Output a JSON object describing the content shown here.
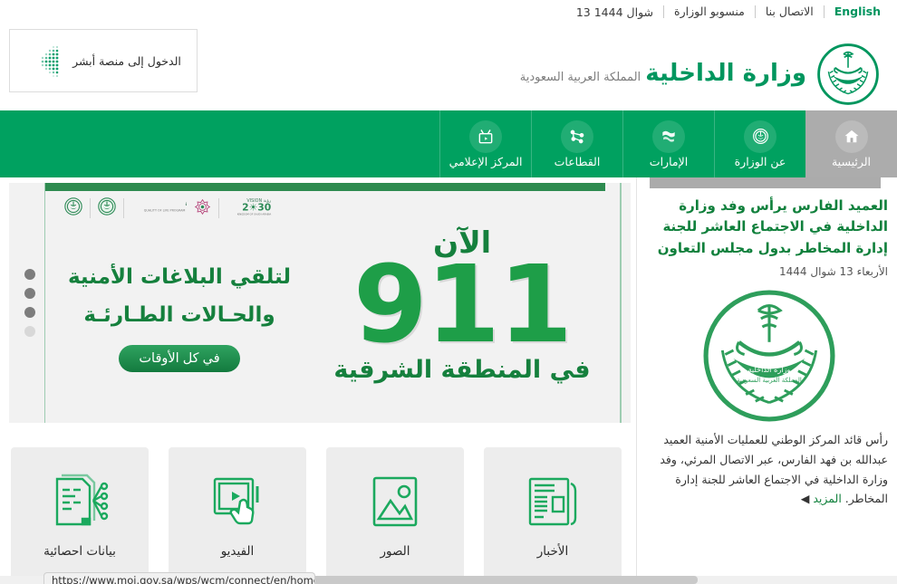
{
  "topbar": {
    "language": "English",
    "links": [
      {
        "label": "الاتصال بنا"
      },
      {
        "label": "منسوبو الوزارة"
      }
    ],
    "date": "13 شوال 1444"
  },
  "header": {
    "absher_label": "الدخول إلى منصة أبشر",
    "brand_title": "وزارة الداخلية",
    "brand_subtitle": "المملكة العربية السعودية"
  },
  "nav": {
    "items": [
      {
        "label": "المركز الإعلامي",
        "icon": "media-tv-icon",
        "active": false
      },
      {
        "label": "القطاعات",
        "icon": "sectors-network-icon",
        "active": false
      },
      {
        "label": "الإمارات",
        "icon": "emirates-icon",
        "active": false
      },
      {
        "label": "عن الوزارة",
        "icon": "ministry-emblem-icon",
        "active": false
      },
      {
        "label": "الرئيسية",
        "icon": "home-icon",
        "active": true
      }
    ]
  },
  "banner": {
    "now_label": "الآن",
    "number": "911",
    "region": "في المنطقة الشرقية",
    "description_line1": "لتلقي البلاغات الأمنية",
    "description_line2": "والحـالات الطـارئـة",
    "pill_label": "في كل الأوقات",
    "partners": [
      {
        "name": "ministry-of-interior-emblem"
      },
      {
        "name": "ministry-emblem-secondary"
      },
      {
        "name": "quality-of-life-program-logo"
      },
      {
        "name": "vision-2030-logo"
      }
    ],
    "dots": [
      {
        "active": true
      },
      {
        "active": true
      },
      {
        "active": true
      },
      {
        "active": false
      }
    ]
  },
  "cards": [
    {
      "label": "الأخبار",
      "icon": "newspaper-icon"
    },
    {
      "label": "الصور",
      "icon": "image-gallery-icon"
    },
    {
      "label": "الفيديو",
      "icon": "video-play-icon"
    },
    {
      "label": "بيانات احصائية",
      "icon": "statistics-document-icon"
    }
  ],
  "news": {
    "title": "العميد الفارس يرأس وفد وزارة الداخلية في الاجتماع العاشر للجنة إدارة المخاطر بدول مجلس التعاون",
    "date": "الأربعاء 13 شوال 1444",
    "body": "رأس قائد المركز الوطني للعمليات الأمنية العميد عبدالله بن فهد الفارس، عبر الاتصال المرئي، وفد وزارة الداخلية في الاجتماع العاشر للجنة إدارة المخاطر.",
    "more_label": "المزيد"
  },
  "status": {
    "url": "https://www.moi.gov.sa/wps/wcm/connect/en/home"
  },
  "colors": {
    "brand_green": "#00965E",
    "nav_green": "#00A160",
    "active_gray": "#ACACAC",
    "banner_bg": "#F2F2F2",
    "card_bg": "#EDEDED",
    "deep_green": "#15803d"
  }
}
